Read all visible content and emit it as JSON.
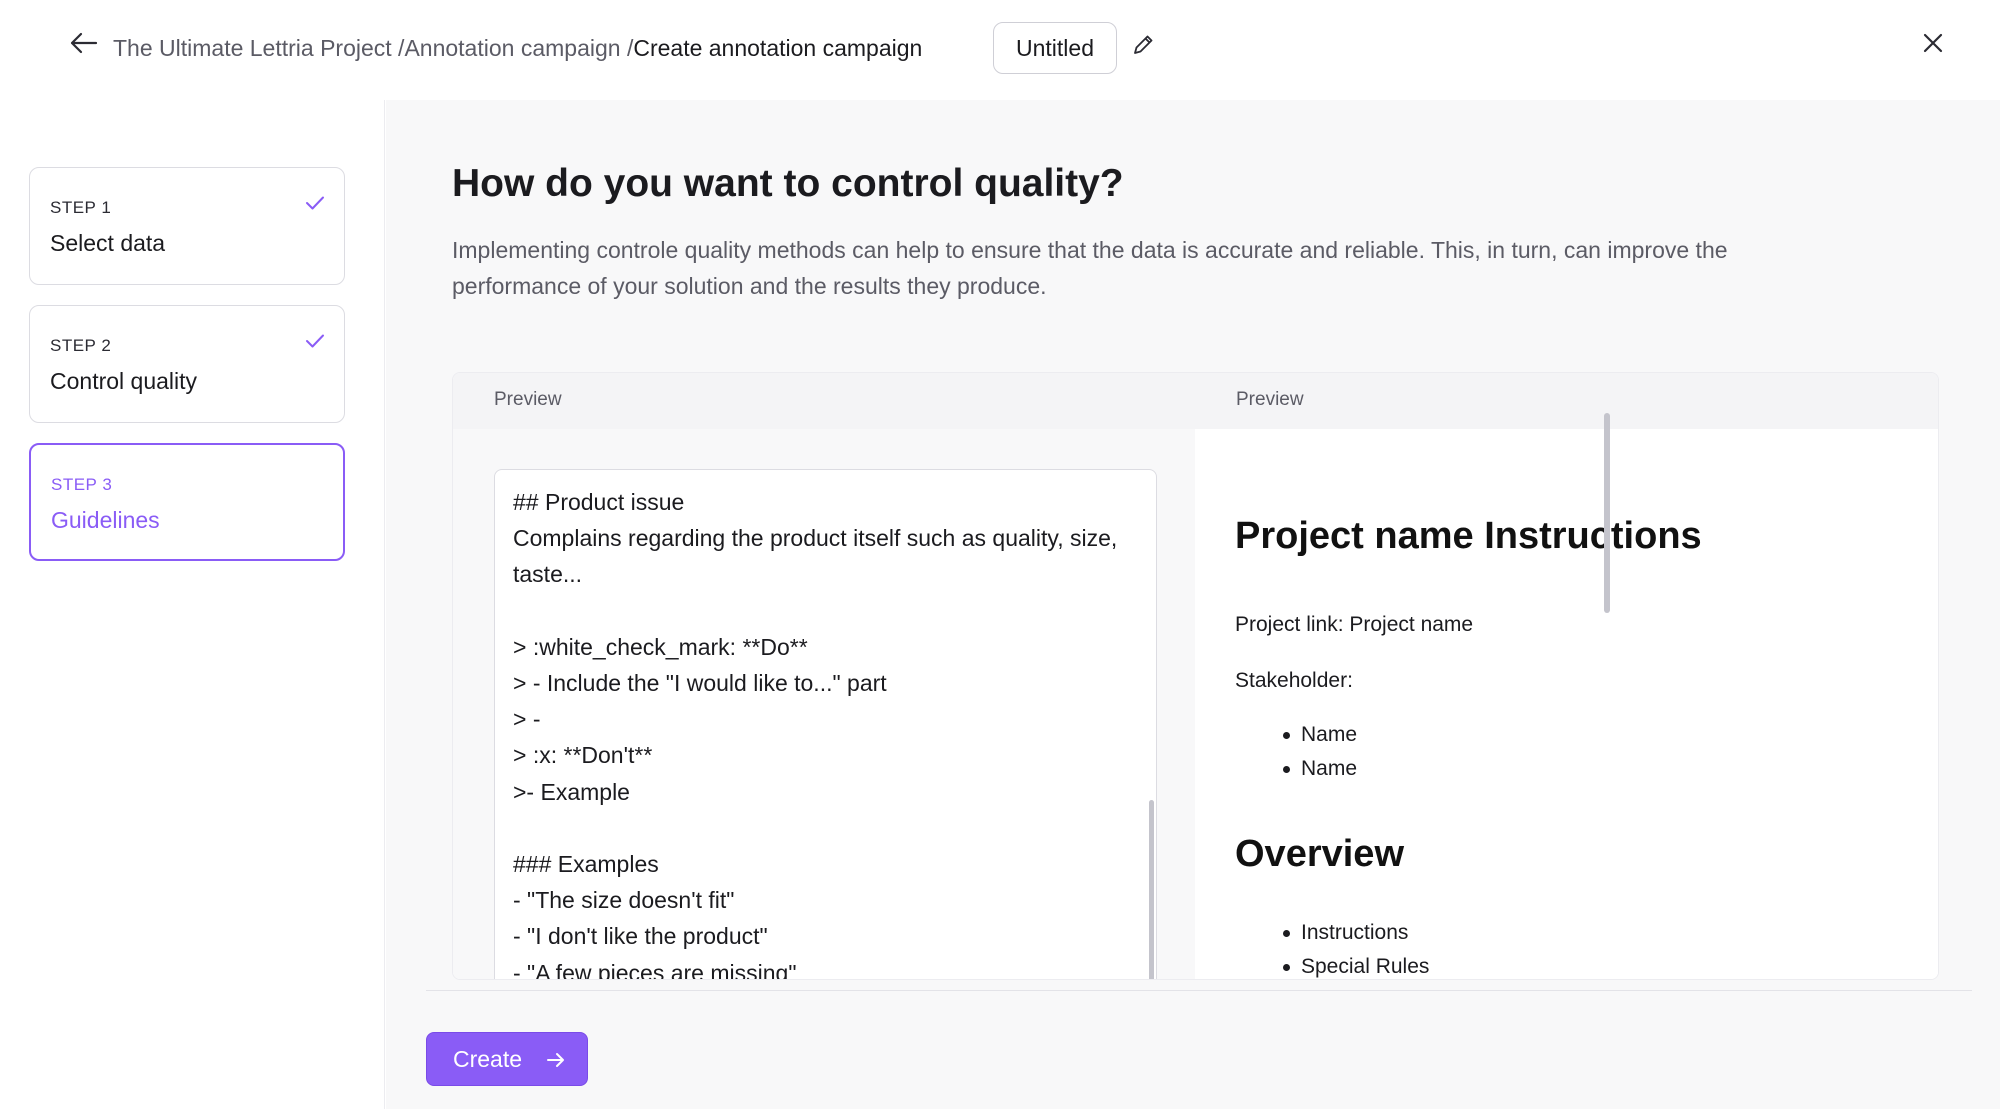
{
  "header": {
    "breadcrumb": [
      {
        "label": "The Ultimate Lettria Project /"
      },
      {
        "label": "Annotation campaign /"
      },
      {
        "label": "Create annotation campaign"
      }
    ],
    "campaign_title": "Untitled",
    "icons": {
      "back": "arrow-left-icon",
      "edit": "pencil-icon",
      "close": "close-icon"
    }
  },
  "steps": [
    {
      "number": "STEP 1",
      "label": "Select data",
      "completed": true
    },
    {
      "number": "STEP 2",
      "label": "Control quality",
      "completed": true
    },
    {
      "number": "STEP 3",
      "label": "Guidelines",
      "active": true
    }
  ],
  "main": {
    "title": "How do you want to control quality?",
    "description": "Implementing controle quality methods can help to ensure that the data is accurate and reliable. This, in turn, can improve the performance of your solution and the results they produce."
  },
  "panel": {
    "left_header": "Preview",
    "right_header": "Preview",
    "editor_text": "## Product issue\nComplains regarding the product itself such as quality, size, taste...\n\n> :white_check_mark: **Do**\n> - Include the \"I would like to...\" part\n> -\n> :x: **Don't**\n>- Example\n\n### Examples\n- \"The size doesn't fit\"\n- \"I don't like the product\"\n- \"A few pieces are missing\"",
    "preview": {
      "heading": "Project name Instructions",
      "project_link": "Project link: Project name",
      "stakeholder": "Stakeholder:",
      "stakeholders": [
        "Name",
        "Name"
      ],
      "overview_heading": "Overview",
      "overview_items": [
        "Instructions",
        "Special Rules"
      ]
    }
  },
  "footer": {
    "create_label": "Create"
  },
  "colors": {
    "accent": "#8a5cf6",
    "border": "#dcdce2",
    "muted_text": "#5b5b65"
  }
}
